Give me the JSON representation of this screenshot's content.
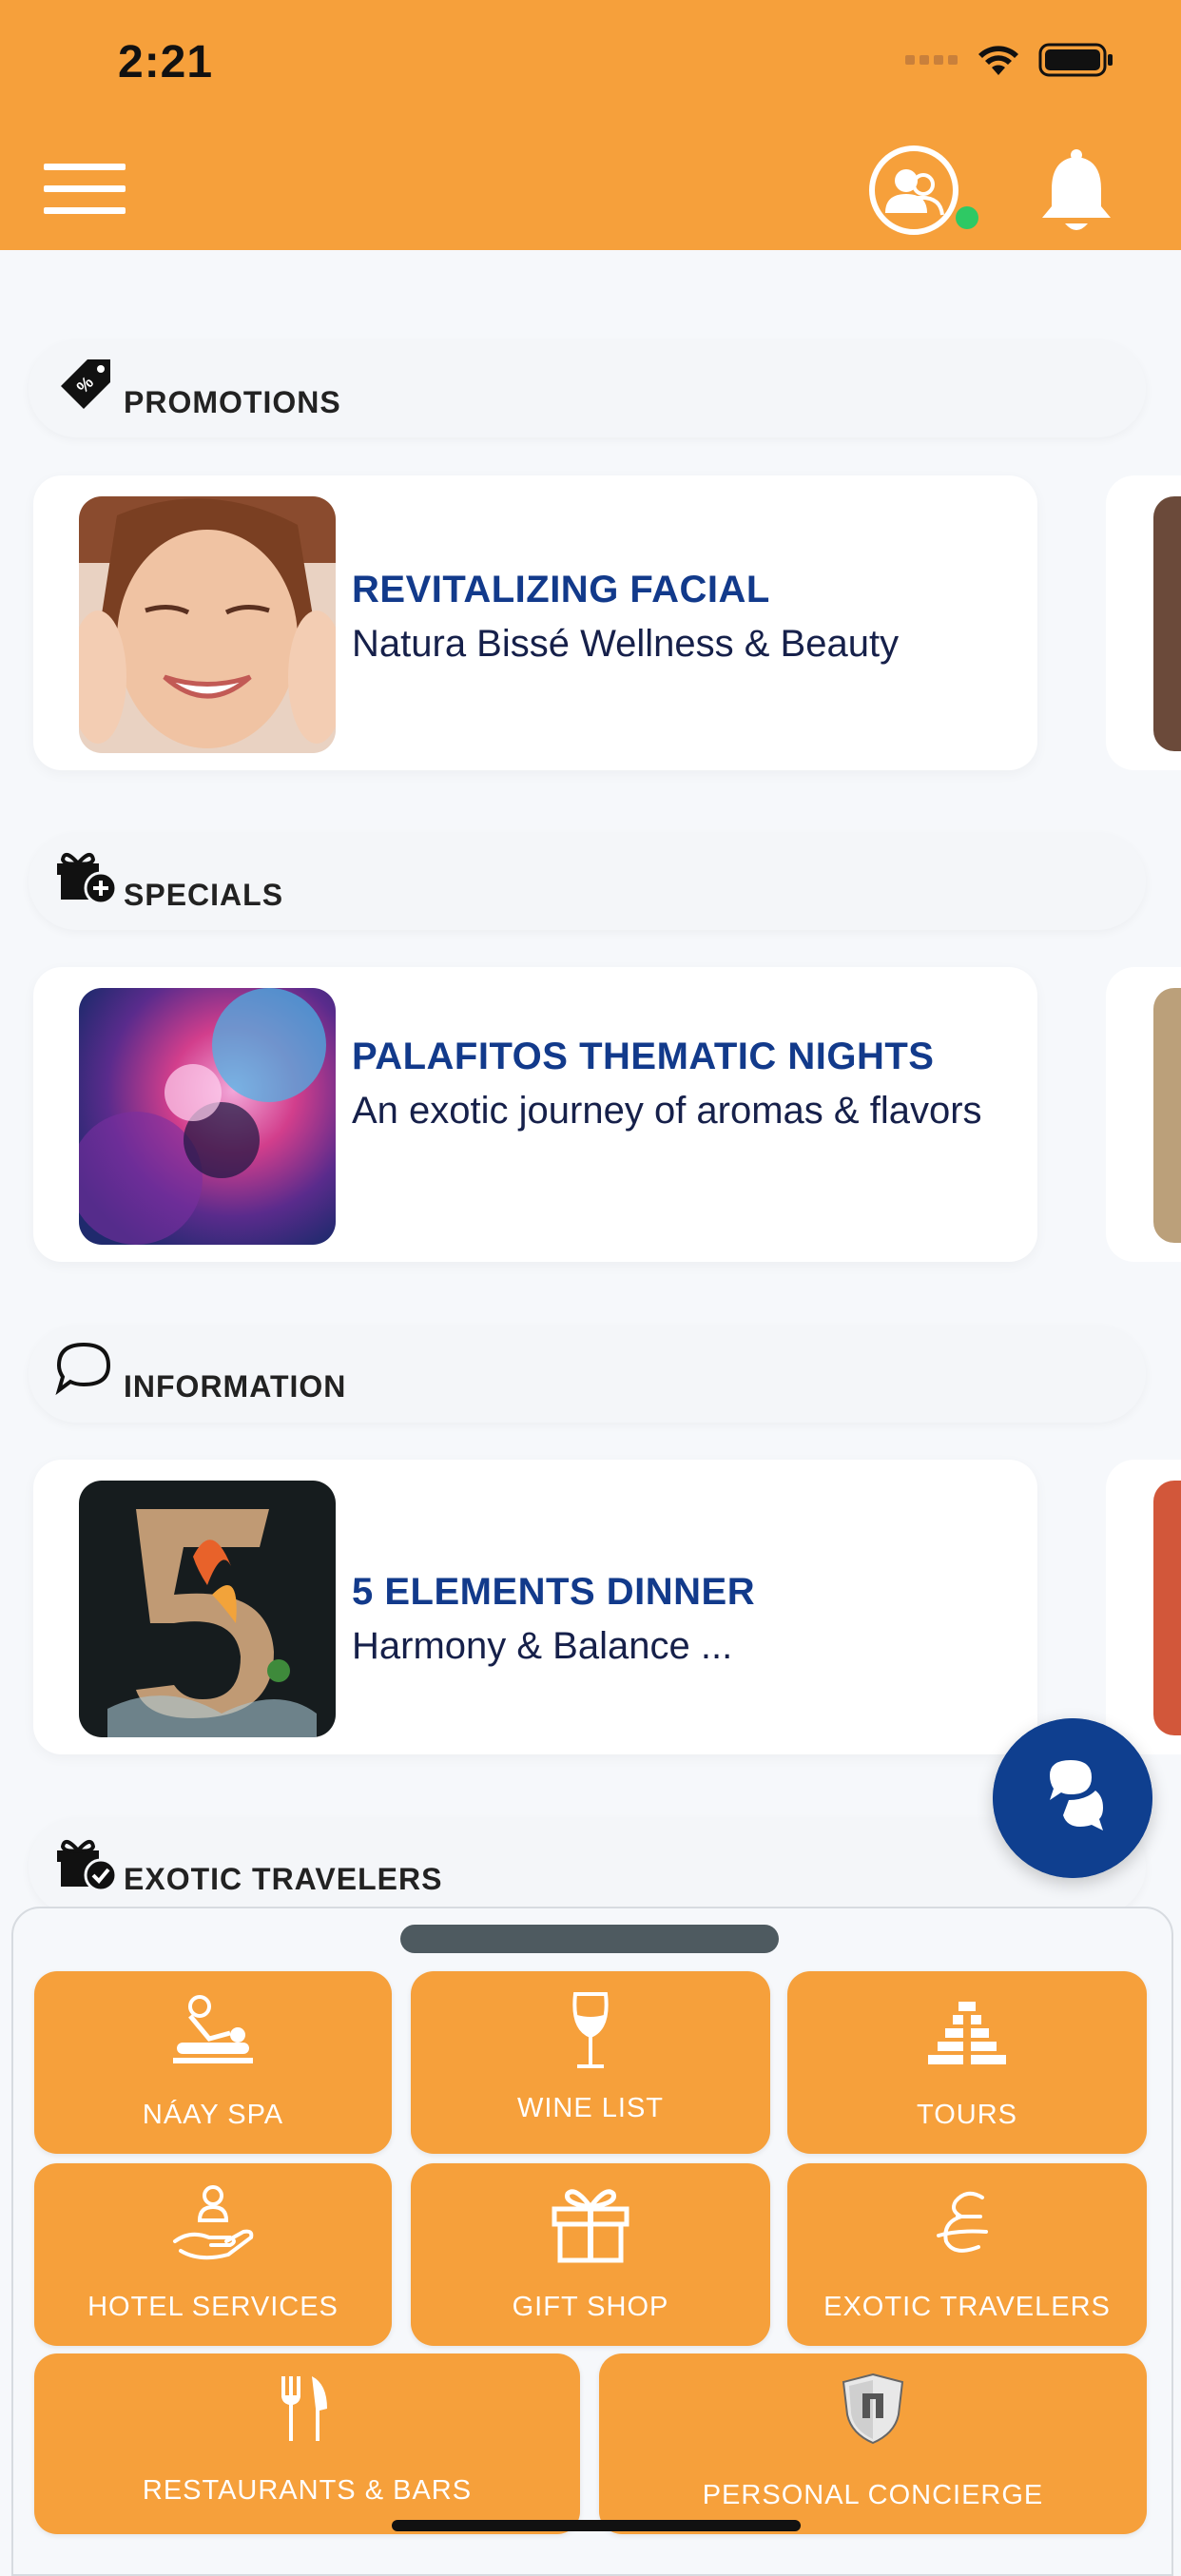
{
  "status_bar": {
    "time": "2:21"
  },
  "header": {
    "menu_icon": "hamburger-icon",
    "profile_icon": "users-icon",
    "notification_icon": "bell-icon",
    "online_color": "#2ec964"
  },
  "sections": [
    {
      "title": "PROMOTIONS",
      "icon": "price-tag-percent-icon",
      "card": {
        "title": "REVITALIZING FACIAL",
        "subtitle": "Natura Bissé Wellness & Beauty"
      }
    },
    {
      "title": "SPECIALS",
      "icon": "gift-plus-icon",
      "card": {
        "title": "PALAFITOS THEMATIC NIGHTS",
        "subtitle": "An exotic journey of aromas & flavors"
      }
    },
    {
      "title": "INFORMATION",
      "icon": "chat-bubble-icon",
      "card": {
        "title": "5 ELEMENTS DINNER",
        "subtitle": "Harmony & Balance ..."
      }
    },
    {
      "title": "EXOTIC TRAVELERS",
      "icon": "gift-check-icon"
    }
  ],
  "chat_button": {
    "icon": "chat-bubbles-icon"
  },
  "quick_menu": [
    {
      "label": "NÁAY SPA",
      "icon": "massage-icon"
    },
    {
      "label": "WINE LIST",
      "icon": "wine-glass-icon"
    },
    {
      "label": "TOURS",
      "icon": "pyramid-icon"
    },
    {
      "label": "HOTEL SERVICES",
      "icon": "service-hand-icon"
    },
    {
      "label": "GIFT SHOP",
      "icon": "gift-icon"
    },
    {
      "label": "EXOTIC TRAVELERS",
      "icon": "script-e-icon"
    },
    {
      "label": "RESTAURANTS & BARS",
      "icon": "fork-knife-icon"
    },
    {
      "label": "PERSONAL CONCIERGE",
      "icon": "shield-icon"
    }
  ],
  "colors": {
    "brand_orange": "#f6a03b",
    "title_blue": "#123a8b",
    "fab_blue": "#0f3f8f"
  }
}
